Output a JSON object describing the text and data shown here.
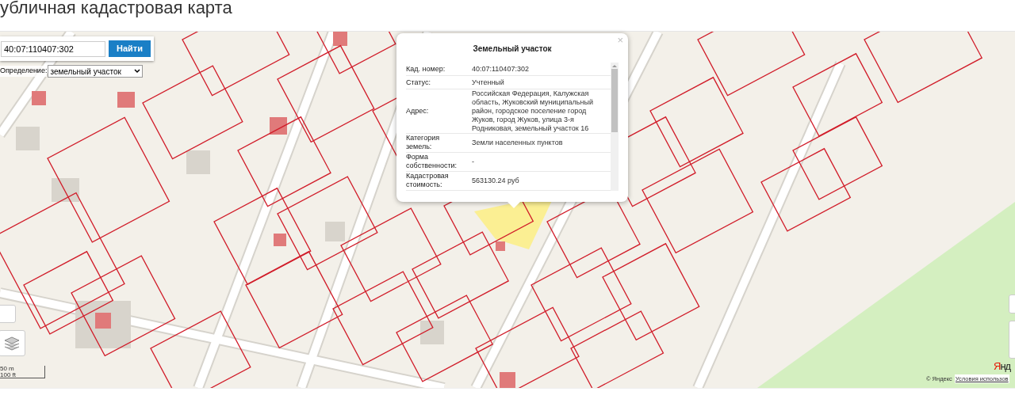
{
  "page": {
    "title": "убличная кадастровая карта"
  },
  "search": {
    "value": "40:07:110407:302",
    "button": "Найти"
  },
  "definition": {
    "label": "Определение:",
    "value": "земельный участок"
  },
  "popup": {
    "title": "Земельный участок",
    "close": "×",
    "rows": [
      {
        "label": "Кад. номер:",
        "value": "40:07:110407:302"
      },
      {
        "label": "Статус:",
        "value": "Учтенный"
      },
      {
        "label": "Адрес:",
        "value": "Российская Федерация, Калужская область, Жуковский муниципальный район, городское поселение город Жуков, город Жуков, улица 3-я Родниковая, земельный участок 16"
      },
      {
        "label": "Категория земель:",
        "value": "Земли населенных пунктов"
      },
      {
        "label": "Форма собственности:",
        "value": "-"
      },
      {
        "label": "Кадастровая стоимость:",
        "value": "563130.24 руб"
      }
    ]
  },
  "scale": {
    "metric": "50 m",
    "imperial": "100 ft"
  },
  "attribution": {
    "logo": "Янд",
    "copyright": "© Яндекс",
    "terms_link": "Условия использов"
  }
}
